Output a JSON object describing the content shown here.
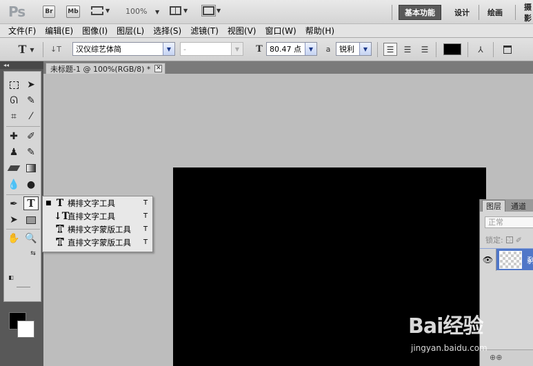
{
  "appbar": {
    "logo": "Ps",
    "bridge": "Br",
    "minibridge": "Mb",
    "zoom": "100%",
    "workspaces": [
      "基本功能",
      "设计",
      "绘画",
      "摄影"
    ]
  },
  "menubar": {
    "items": [
      "文件(F)",
      "编辑(E)",
      "图像(I)",
      "图层(L)",
      "选择(S)",
      "滤镜(T)",
      "视图(V)",
      "窗口(W)",
      "帮助(H)"
    ]
  },
  "options": {
    "tool_glyph": "T",
    "font_family": "汉仪综艺体简",
    "font_style": "-",
    "font_size": "80.47 点",
    "aa_label": "a",
    "antialias": "锐利",
    "text_color": "#000000"
  },
  "document": {
    "tab_title": "未标题-1 @ 100%(RGB/8) *",
    "close": "✕",
    "canvas_color": "#000000"
  },
  "flyout": {
    "items": [
      {
        "label": "横排文字工具",
        "shortcut": "T",
        "icon": "horizontal-type-icon",
        "selected": true
      },
      {
        "label": "直排文字工具",
        "shortcut": "T",
        "icon": "vertical-type-icon",
        "selected": false
      },
      {
        "label": "横排文字蒙版工具",
        "shortcut": "T",
        "icon": "horizontal-type-mask-icon",
        "selected": false
      },
      {
        "label": "直排文字蒙版工具",
        "shortcut": "T",
        "icon": "vertical-type-mask-icon",
        "selected": false
      }
    ]
  },
  "layers": {
    "tabs": [
      "图层",
      "通道"
    ],
    "blend_mode": "正常",
    "lock_label": "锁定:",
    "layer_name": "剢",
    "footer": "⊕⊕"
  },
  "watermark": {
    "logo": "Bai经验",
    "sub": "jingyan.baidu.com"
  },
  "colors": {
    "accent": "#5077c8",
    "workspace_active": "#5a5a5a",
    "panel_bg": "#d6d6d6"
  }
}
